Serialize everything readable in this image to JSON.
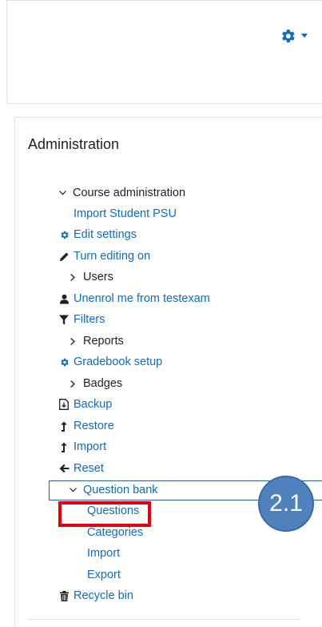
{
  "header": {
    "settings_icon": "gear-icon",
    "dropdown_icon": "caret-down-icon"
  },
  "admin": {
    "title": "Administration",
    "course_admin": "Course administration",
    "items": {
      "import_student": "Import Student PSU",
      "edit_settings": "Edit settings",
      "turn_editing": "Turn editing on",
      "users": "Users",
      "unenrol": "Unenrol me from testexam",
      "filters": "Filters",
      "reports": "Reports",
      "gradebook": "Gradebook setup",
      "badges": "Badges",
      "backup": "Backup",
      "restore": "Restore",
      "import": "Import",
      "reset": "Reset",
      "question_bank": "Question bank",
      "questions": "Questions",
      "categories": "Categories",
      "qb_import": "Import",
      "qb_export": "Export",
      "recycle_bin": "Recycle bin"
    }
  },
  "annotation": {
    "label": "2.1",
    "highlight_color": "#e3000b",
    "circle_color": "#4f81bd"
  },
  "colors": {
    "link": "#0f6cbf",
    "text": "#1d2125",
    "border": "#dee2e6"
  }
}
